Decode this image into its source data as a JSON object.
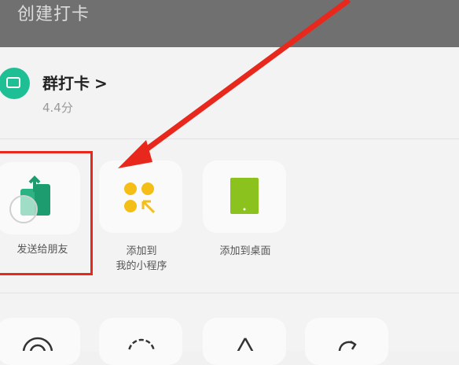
{
  "header": {
    "title": "创建打卡"
  },
  "app": {
    "name": "群打卡",
    "chevron": ">",
    "rating": "4.4分"
  },
  "actions": [
    {
      "label_lines": [
        "发送给朋友"
      ]
    },
    {
      "label_lines": [
        "添加到",
        "我的小程序"
      ]
    },
    {
      "label_lines": [
        "添加到桌面"
      ]
    }
  ],
  "colors": {
    "highlight": "#e8281c",
    "accent_green": "#1fbf96",
    "icon_yellow": "#f5be16",
    "icon_lime": "#8cc21d"
  }
}
